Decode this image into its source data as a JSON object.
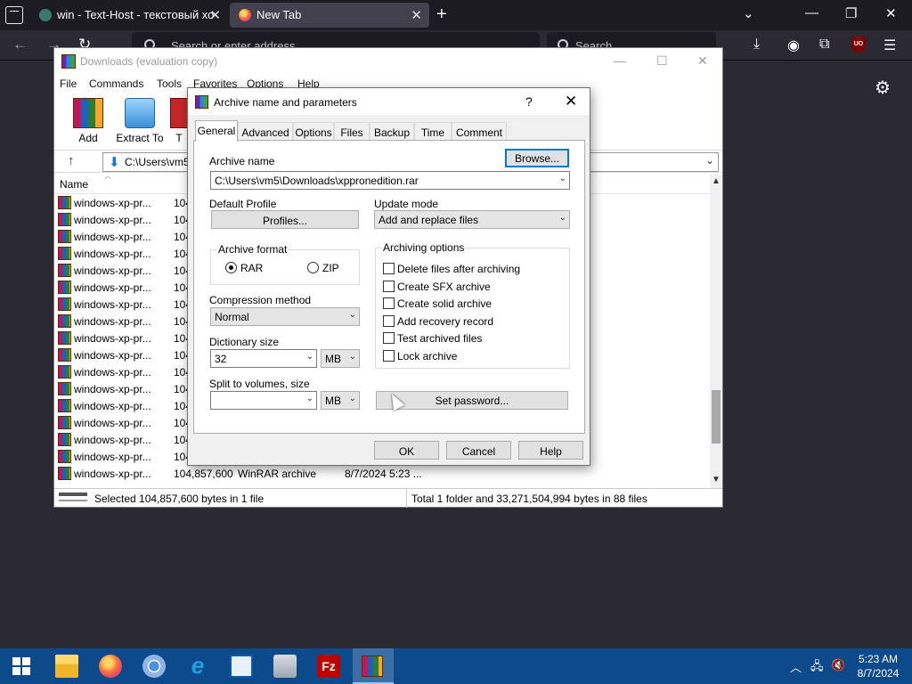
{
  "browser": {
    "tabs": [
      {
        "label": "win - Text-Host - текстовый хо",
        "active": false
      },
      {
        "label": "New Tab",
        "active": true
      }
    ],
    "new_tab_label": "+",
    "url_placeholder": "Search or enter address",
    "search_placeholder": "Search",
    "ublock_label": "UO"
  },
  "winrar": {
    "title": "Downloads (evaluation copy)",
    "menu": [
      "File",
      "Commands",
      "Tools",
      "Favorites",
      "Options",
      "Help"
    ],
    "toolbar": {
      "add_label": "Add",
      "extract_label": "Extract To",
      "test_label": "T"
    },
    "address": "C:\\Users\\vm5",
    "column_name": "Name",
    "files": [
      {
        "name": "windows-xp-pr...",
        "size": "104"
      },
      {
        "name": "windows-xp-pr...",
        "size": "104"
      },
      {
        "name": "windows-xp-pr...",
        "size": "104"
      },
      {
        "name": "windows-xp-pr...",
        "size": "104"
      },
      {
        "name": "windows-xp-pr...",
        "size": "104"
      },
      {
        "name": "windows-xp-pr...",
        "size": "104"
      },
      {
        "name": "windows-xp-pr...",
        "size": "104"
      },
      {
        "name": "windows-xp-pr...",
        "size": "104"
      },
      {
        "name": "windows-xp-pr...",
        "size": "104"
      },
      {
        "name": "windows-xp-pr...",
        "size": "104"
      },
      {
        "name": "windows-xp-pr...",
        "size": "104"
      },
      {
        "name": "windows-xp-pr...",
        "size": "104"
      },
      {
        "name": "windows-xp-pr...",
        "size": "104"
      },
      {
        "name": "windows-xp-pr...",
        "size": "104"
      },
      {
        "name": "windows-xp-pr...",
        "size": "104"
      },
      {
        "name": "windows-xp-pr...",
        "size": "104"
      },
      {
        "name": "windows-xp-pr...",
        "size": "104,857,600",
        "type": "WinRAR archive",
        "date": "8/7/2024 5:23 ..."
      }
    ],
    "status_left": "Selected 104,857,600 bytes in 1 file",
    "status_right": "Total 1 folder and 33,271,504,994 bytes in 88 files"
  },
  "dialog": {
    "title": "Archive name and parameters",
    "help_glyph": "?",
    "tabs": [
      "General",
      "Advanced",
      "Options",
      "Files",
      "Backup",
      "Time",
      "Comment"
    ],
    "active_tab": "General",
    "archive_name_label": "Archive name",
    "archive_name_value": "C:\\Users\\vm5\\Downloads\\xppronedition.rar",
    "browse_label": "Browse...",
    "default_profile_label": "Default Profile",
    "profiles_label": "Profiles...",
    "update_mode_label": "Update mode",
    "update_mode_value": "Add and replace files",
    "archive_format_label": "Archive format",
    "format_rar": "RAR",
    "format_zip": "ZIP",
    "selected_format": "RAR",
    "compression_method_label": "Compression method",
    "compression_method_value": "Normal",
    "dictionary_size_label": "Dictionary size",
    "dictionary_size_value": "32",
    "dictionary_unit": "MB",
    "split_label": "Split to volumes, size",
    "split_value": "",
    "split_unit": "MB",
    "archiving_options_label": "Archiving options",
    "options": [
      {
        "label": "Delete files after archiving",
        "checked": false
      },
      {
        "label": "Create SFX archive",
        "checked": false
      },
      {
        "label": "Create solid archive",
        "checked": false
      },
      {
        "label": "Add recovery record",
        "checked": false
      },
      {
        "label": "Test archived files",
        "checked": false
      },
      {
        "label": "Lock archive",
        "checked": false
      }
    ],
    "set_password_label": "Set password...",
    "ok_label": "OK",
    "cancel_label": "Cancel",
    "help_label": "Help"
  },
  "taskbar": {
    "fz_label": "Fz",
    "ie_label": "e",
    "time": "5:23 AM",
    "date": "8/7/2024"
  },
  "colors": {
    "taskbar": "#0c4a8c",
    "browser_bg": "#2b2a33",
    "focus_border": "#0078d7"
  }
}
